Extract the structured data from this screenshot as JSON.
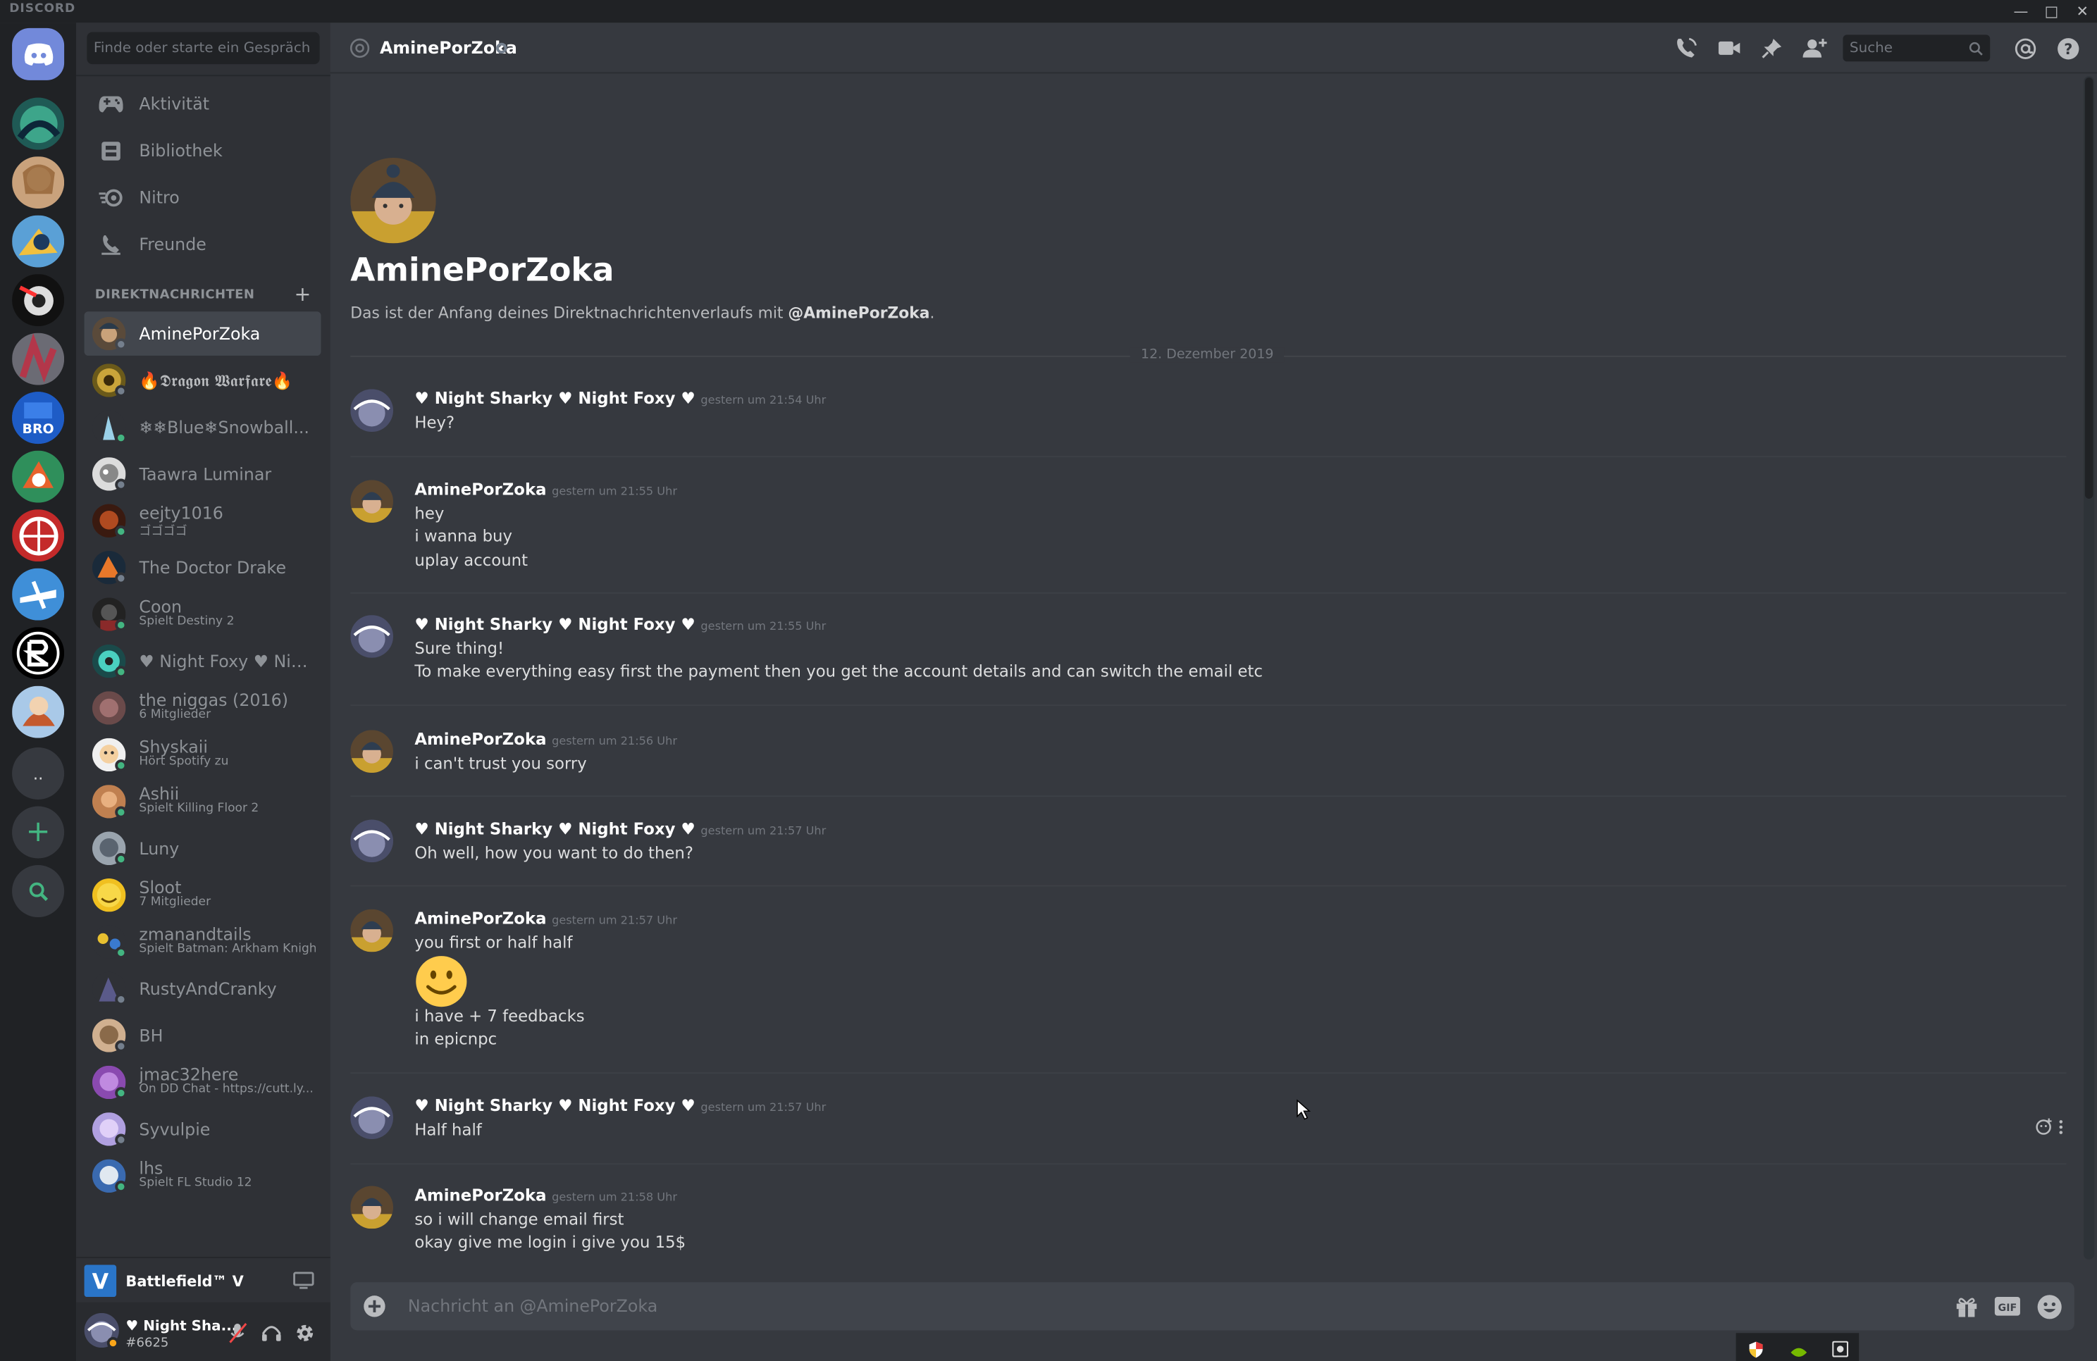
{
  "titlebar": {
    "brand": "DISCORD"
  },
  "dm_sidebar": {
    "search_placeholder": "Finde oder starte ein Gespräch",
    "nav": [
      {
        "label": "Aktivität",
        "icon": "gamepad-icon"
      },
      {
        "label": "Bibliothek",
        "icon": "library-icon"
      },
      {
        "label": "Nitro",
        "icon": "nitro-icon"
      },
      {
        "label": "Freunde",
        "icon": "friends-icon"
      }
    ],
    "section_title": "DIREKTNACHRICHTEN",
    "dms": [
      {
        "name": "AminePorZoka",
        "sub": "",
        "status": "offline"
      },
      {
        "name": "🔥𝕯𝖗𝖆𝖌𝖔𝖓 𝖂𝖆𝖗𝖋𝖆𝖗𝖊🔥",
        "sub": "",
        "status": "offline"
      },
      {
        "name": "❄❄Blue❄Snowball...",
        "sub": "",
        "status": "online"
      },
      {
        "name": "Taawra Luminar",
        "sub": "",
        "status": "offline"
      },
      {
        "name": "eejty1016",
        "sub": "ゴゴゴゴ",
        "status": "online"
      },
      {
        "name": "The Doctor Drake",
        "sub": "",
        "status": "offline"
      },
      {
        "name": "Coon",
        "sub": "Spielt Destiny 2",
        "status": "online"
      },
      {
        "name": "♥ Night Foxy ♥ Night ...",
        "sub": "",
        "status": "online"
      },
      {
        "name": "the niggas (2016)",
        "sub": "6 Mitglieder",
        "status": "none"
      },
      {
        "name": "Shyskaii",
        "sub": "Hört Spotify zu",
        "status": "online"
      },
      {
        "name": "Ashii",
        "sub": "Spielt Killing Floor 2",
        "status": "online"
      },
      {
        "name": "Luny",
        "sub": "",
        "status": "online"
      },
      {
        "name": "Sloot",
        "sub": "7 Mitglieder",
        "status": "none"
      },
      {
        "name": "zmanandtails",
        "sub": "Spielt Batman: Arkham Knight",
        "status": "online"
      },
      {
        "name": "RustyAndCranky",
        "sub": "",
        "status": "offline"
      },
      {
        "name": "BH",
        "sub": "",
        "status": "offline"
      },
      {
        "name": "jmac32here",
        "sub": "On DD Chat - https://cutt.ly...",
        "status": "online"
      },
      {
        "name": "Syvulpie",
        "sub": "",
        "status": "offline"
      },
      {
        "name": "lhs",
        "sub": "Spielt FL Studio 12",
        "status": "online"
      }
    ],
    "game": {
      "name": "Battlefield™ V",
      "logo": "V"
    },
    "user": {
      "name": "♥ Night Sha...",
      "tag": "#6625"
    }
  },
  "topbar": {
    "channel_name": "AminePorZoka",
    "search_placeholder": "Suche"
  },
  "conversation": {
    "intro_title": "AminePorZoka",
    "intro_prefix": "Das ist der Anfang deines Direktnachrichtenverlaufs mit ",
    "intro_mention": "@AminePorZoka",
    "intro_suffix": ".",
    "date_divider": "12. Dezember 2019",
    "messages": [
      {
        "author": "♥ Night Sharky ♥ Night Foxy ♥",
        "time": "gestern um 21:54 Uhr",
        "lines": [
          "Hey?"
        ]
      },
      {
        "author": "AminePorZoka",
        "time": "gestern um 21:55 Uhr",
        "lines": [
          "hey",
          "i wanna buy",
          "uplay account"
        ]
      },
      {
        "author": "♥ Night Sharky ♥ Night Foxy ♥",
        "time": "gestern um 21:55 Uhr",
        "lines": [
          "Sure thing!",
          "To make everything easy first the payment then you get the account details and can switch the email etc"
        ]
      },
      {
        "author": "AminePorZoka",
        "time": "gestern um 21:56 Uhr",
        "lines": [
          "i can't trust you sorry"
        ]
      },
      {
        "author": "♥ Night Sharky ♥ Night Foxy ♥",
        "time": "gestern um 21:57 Uhr",
        "lines": [
          "Oh well, how you want to do then?"
        ]
      },
      {
        "author": "AminePorZoka",
        "time": "gestern um 21:57 Uhr",
        "lines": [
          "you first or half half",
          "i have + 7 feedbacks",
          "in epicnpc"
        ],
        "emoji": "slightly-smiling-face"
      },
      {
        "author": "♥ Night Sharky ♥ Night Foxy ♥",
        "time": "gestern um 21:57 Uhr",
        "lines": [
          "Half half"
        ]
      },
      {
        "author": "AminePorZoka",
        "time": "gestern um 21:58 Uhr",
        "lines": [
          "so i will change email first",
          "okay give me login i give you 15$"
        ]
      }
    ]
  },
  "composer": {
    "placeholder": "Nachricht an @AminePorZoka",
    "gif_label": "GIF"
  },
  "colors": {
    "online": "#43b581",
    "offline": "#747f8d",
    "idle": "#faa61a",
    "blurple": "#7289da"
  }
}
